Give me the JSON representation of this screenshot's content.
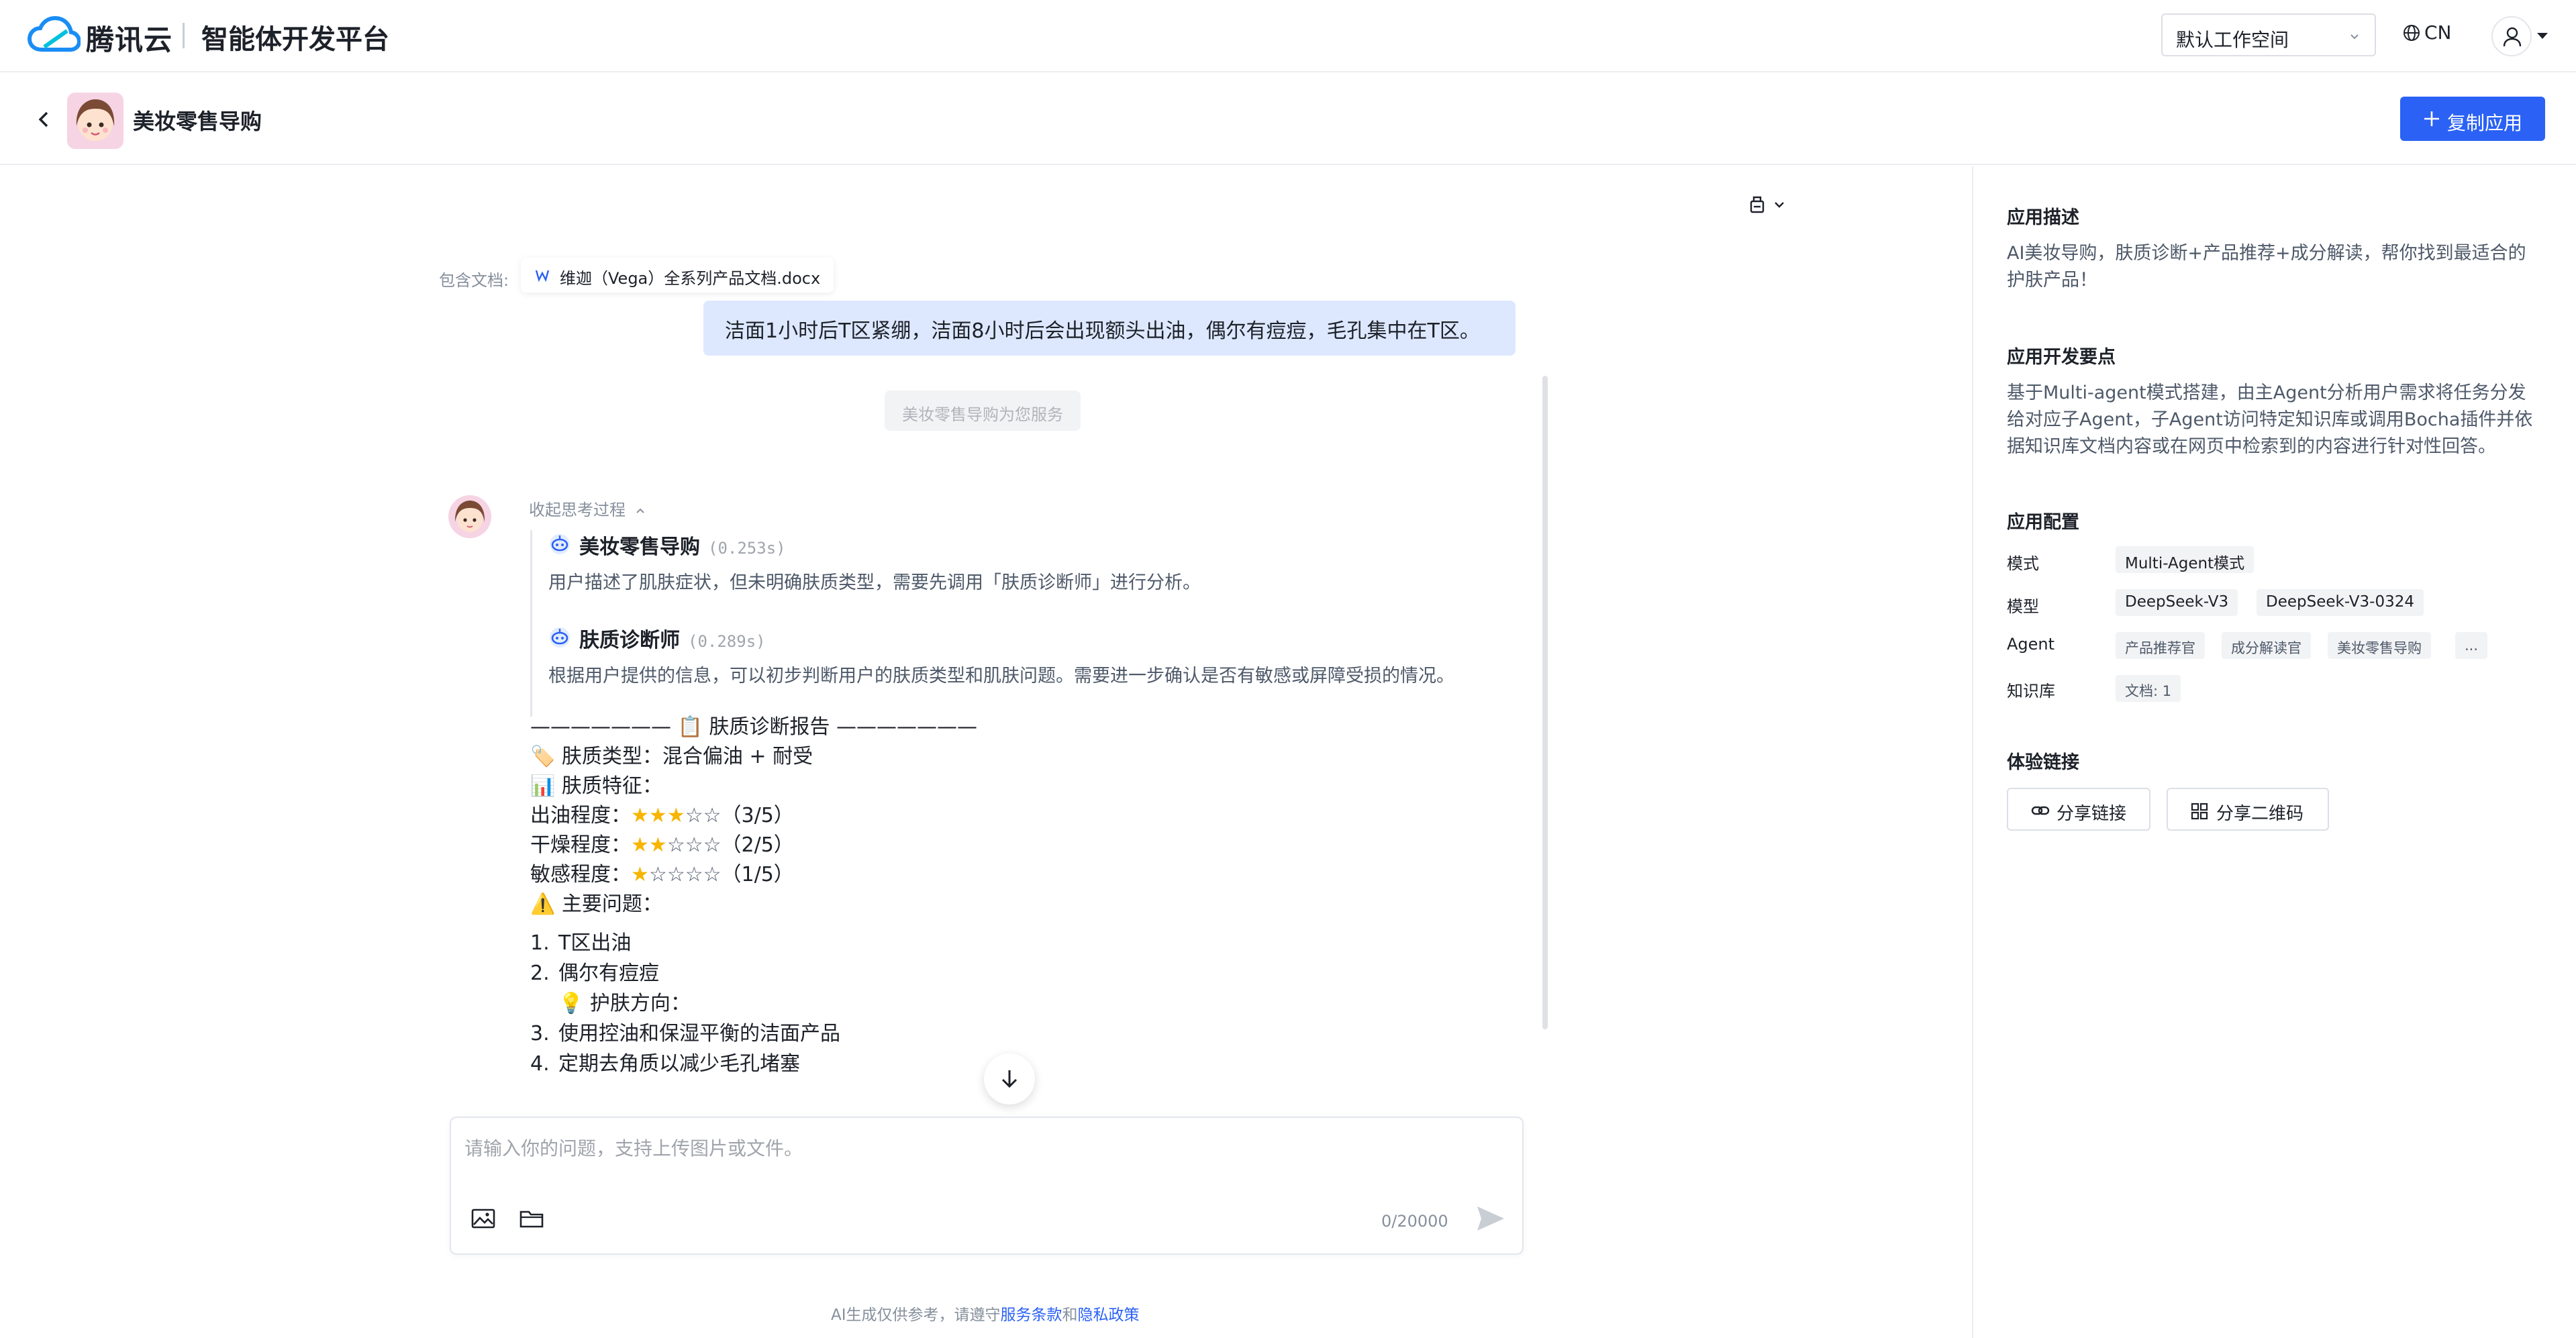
{
  "topnav": {
    "brand": "腾讯云",
    "platform": "智能体开发平台",
    "workspace": "默认工作空间",
    "language": "CN"
  },
  "header": {
    "app_name": "美妆零售导购",
    "copy_button": "复制应用"
  },
  "chat": {
    "docs_label": "包含文档:",
    "doc_name": "维迦（Vega）全系列产品文档.docx",
    "user_message": "洁面1小时后T区紧绷，洁面8小时后会出现额头出油，偶尔有痘痘，毛孔集中在T区。",
    "service_notice": "美妆零售导购为您服务",
    "collapse_label": "收起思考过程",
    "thinking": [
      {
        "agent": "美妆零售导购",
        "time": "(0.253s)",
        "text": "用户描述了肌肤症状，但未明确肤质类型，需要先调用「肤质诊断师」进行分析。"
      },
      {
        "agent": "肤质诊断师",
        "time": "(0.289s)",
        "text": "根据用户提供的信息，可以初步判断用户的肤质类型和肌肤问题。需要进一步确认是否有敏感或屏障受损的情况。"
      }
    ],
    "report": {
      "title": "——————— 📋 肤质诊断报告 ———————",
      "skin_type": "🏷️ 肤质类型：混合偏油 + 耐受",
      "features_label": "📊 肤质特征：",
      "oil_label": "出油程度：",
      "oil_score": "（3/5）",
      "oil_level": 3,
      "dry_label": "干燥程度：",
      "dry_score": "（2/5）",
      "dry_level": 2,
      "sensitive_label": "敏感程度：",
      "sensitive_score": "（1/5）",
      "sensitive_level": 1,
      "issues_label": "⚠️ 主要问题：",
      "items": [
        {
          "n": "1.",
          "text": "T区出油"
        },
        {
          "n": "2.",
          "text": "偶尔有痘痘"
        },
        {
          "n": "3.",
          "text": "使用控油和保湿平衡的洁面产品"
        },
        {
          "n": "4.",
          "text": "定期去角质以减少毛孔堵塞"
        }
      ],
      "tip_label": "💡 护肤方向："
    },
    "input_placeholder": "请输入你的问题，支持上传图片或文件。",
    "counter": "0/20000",
    "disclaimer_prefix": "AI生成仅供参考，请遵守",
    "terms_link": "服务条款",
    "and": "和",
    "privacy_link": "隐私政策"
  },
  "panel": {
    "desc_title": "应用描述",
    "desc_text": "AI美妆导购，肤质诊断+产品推荐+成分解读，帮你找到最适合的护肤产品！",
    "dev_title": "应用开发要点",
    "dev_text": "基于Multi-agent模式搭建，由主Agent分析用户需求将任务分发给对应子Agent，子Agent访问特定知识库或调用Bocha插件并依据知识库文档内容或在网页中检索到的内容进行针对性回答。",
    "config_title": "应用配置",
    "mode_label": "模式",
    "mode_value": "Multi-Agent模式",
    "model_label": "模型",
    "models": [
      "DeepSeek-V3",
      "DeepSeek-V3-0324"
    ],
    "agent_label": "Agent",
    "agents": [
      "产品推荐官",
      "成分解读官",
      "美妆零售导购",
      "..."
    ],
    "kb_label": "知识库",
    "kb_value": "文档: 1",
    "links_title": "体验链接",
    "share_link": "分享链接",
    "share_qr": "分享二维码"
  },
  "colors": {
    "primary": "#2b62f5",
    "user_bubble": "#dde8ff",
    "star": "#f7b500"
  }
}
